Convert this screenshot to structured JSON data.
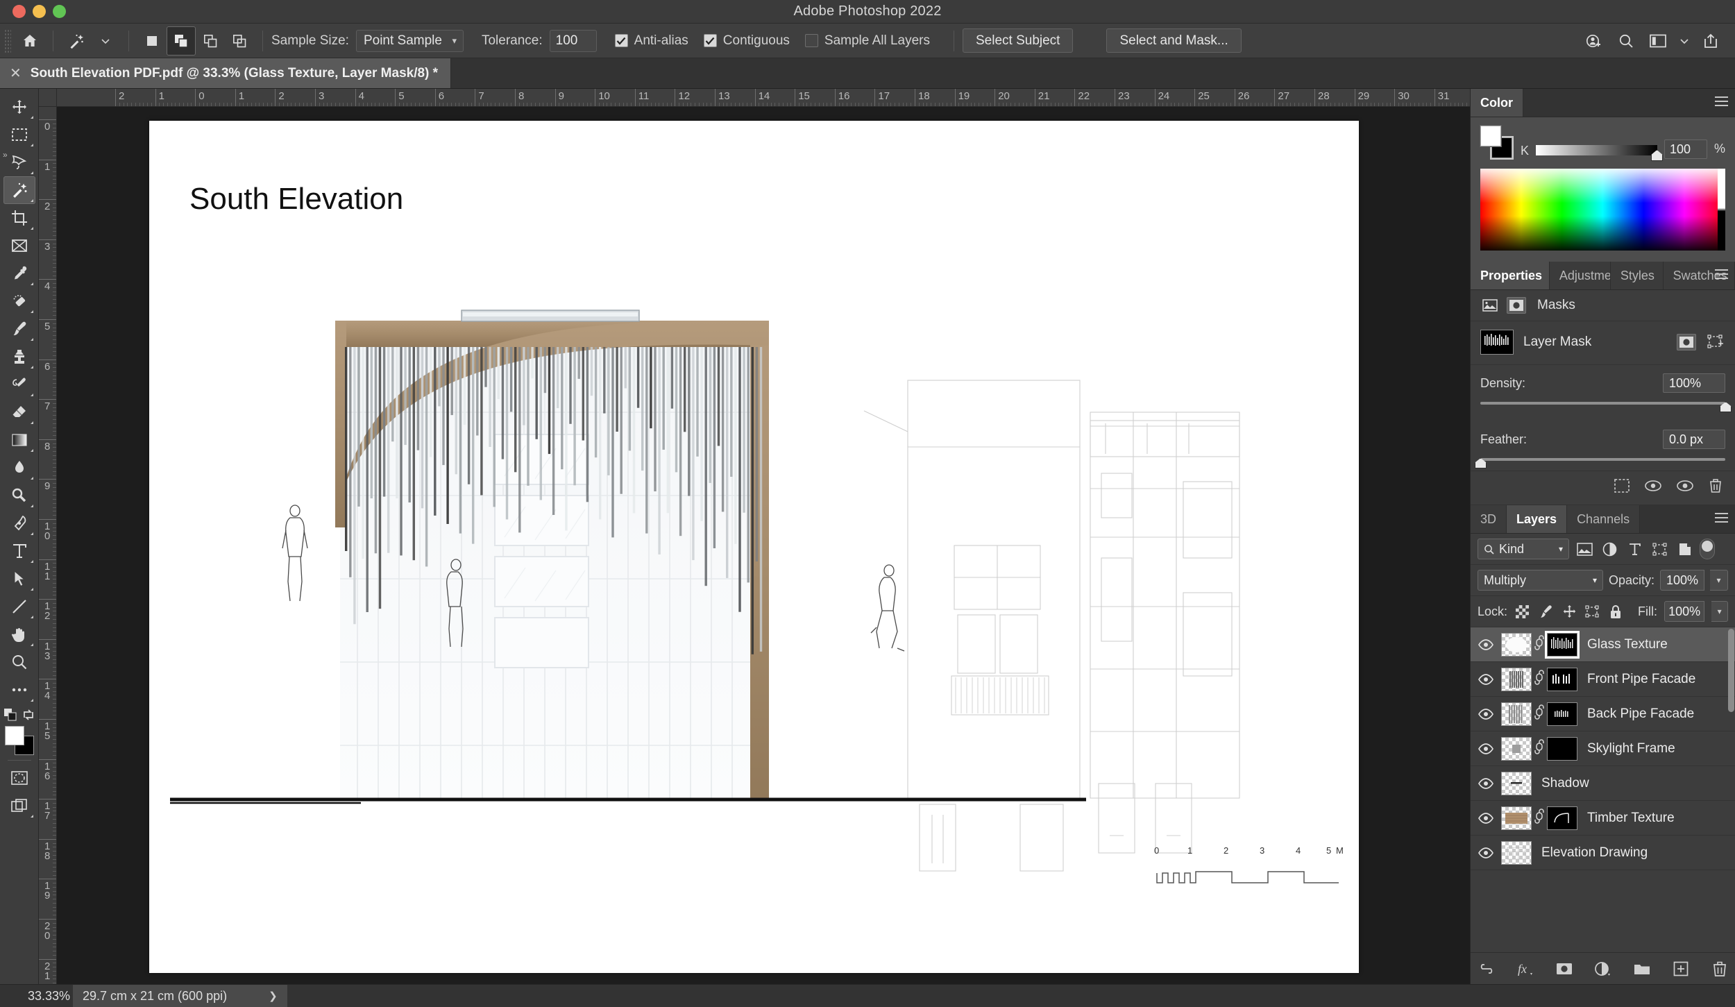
{
  "window": {
    "app_title": "Adobe Photoshop 2022"
  },
  "options_bar": {
    "home_icon": "home-icon",
    "tool_icon": "magic-wand-icon",
    "selection_modes": [
      "new-selection",
      "add-to-selection",
      "subtract-from-selection",
      "intersect-with-selection"
    ],
    "sample_size_label": "Sample Size:",
    "sample_size_value": "Point Sample",
    "tolerance_label": "Tolerance:",
    "tolerance_value": "100",
    "anti_alias_label": "Anti-alias",
    "anti_alias_checked": true,
    "contiguous_label": "Contiguous",
    "contiguous_checked": true,
    "sample_all_layers_label": "Sample All Layers",
    "sample_all_layers_checked": false,
    "select_subject_label": "Select Subject",
    "select_and_mask_label": "Select and Mask...",
    "right_icons": [
      "add-user-icon",
      "search-icon",
      "workspace-icon",
      "chevron-down-icon",
      "share-icon"
    ]
  },
  "document_tab": {
    "close_icon": "close-icon",
    "title": "South Elevation PDF.pdf @ 33.3% (Glass Texture, Layer Mask/8) *"
  },
  "toolbar": {
    "tools": [
      {
        "name": "move-tool",
        "active": false
      },
      {
        "name": "rectangular-marquee-tool",
        "active": false
      },
      {
        "name": "lasso-tool",
        "active": false
      },
      {
        "name": "magic-wand-tool",
        "active": true
      },
      {
        "name": "crop-tool",
        "active": false
      },
      {
        "name": "frame-tool",
        "active": false
      },
      {
        "name": "eyedropper-tool",
        "active": false
      },
      {
        "name": "spot-healing-brush-tool",
        "active": false
      },
      {
        "name": "brush-tool",
        "active": false
      },
      {
        "name": "clone-stamp-tool",
        "active": false
      },
      {
        "name": "history-brush-tool",
        "active": false
      },
      {
        "name": "eraser-tool",
        "active": false
      },
      {
        "name": "gradient-tool",
        "active": false
      },
      {
        "name": "blur-tool",
        "active": false
      },
      {
        "name": "dodge-tool",
        "active": false
      },
      {
        "name": "pen-tool",
        "active": false
      },
      {
        "name": "type-tool",
        "active": false
      },
      {
        "name": "path-selection-tool",
        "active": false
      },
      {
        "name": "line-tool",
        "active": false
      },
      {
        "name": "hand-tool",
        "active": false
      },
      {
        "name": "zoom-tool",
        "active": false
      },
      {
        "name": "edit-toolbar-tool",
        "active": false
      }
    ],
    "foreground_color": "#ffffff",
    "background_color": "#000000",
    "quick_mask_icon": "quick-mask-icon",
    "screen_mode_icon": "screen-mode-icon"
  },
  "rulers": {
    "unit": "cm",
    "horizontal_labels": [
      "2",
      "1",
      "0",
      "1",
      "2",
      "3",
      "4",
      "5",
      "6",
      "7",
      "8",
      "9",
      "10",
      "11",
      "12",
      "13",
      "14",
      "15",
      "16",
      "17",
      "18",
      "19",
      "20",
      "21",
      "22",
      "23",
      "24",
      "25",
      "26",
      "27",
      "28",
      "29",
      "30",
      "31"
    ],
    "vertical_labels": [
      "0",
      "1",
      "2",
      "3",
      "4",
      "5",
      "6",
      "7",
      "8",
      "9",
      "10",
      "11",
      "12",
      "13",
      "14",
      "15",
      "16",
      "17",
      "18",
      "19",
      "20",
      "21"
    ]
  },
  "canvas": {
    "drawing_title": "South Elevation",
    "scale_bar": {
      "labels": [
        "0",
        "1",
        "2",
        "3",
        "4",
        "5"
      ],
      "unit": "M"
    }
  },
  "color_panel": {
    "tab_label": "Color",
    "menu_icon": "panel-menu-icon",
    "channel_label": "K",
    "channel_value": "100",
    "unit": "%"
  },
  "properties_panel": {
    "tabs": [
      {
        "label": "Properties",
        "active": true
      },
      {
        "label": "Adjustme",
        "active": false
      },
      {
        "label": "Styles",
        "active": false
      },
      {
        "label": "Swatches",
        "active": false
      }
    ],
    "menu_icon": "panel-menu-icon",
    "header_label": "Masks",
    "pixel_mask_icon": "pixel-mask-icon",
    "vector_mask_icon": "vector-mask-icon",
    "mask_name": "Layer Mask",
    "select_mask_icon": "select-mask-icon",
    "add_vector_mask_icon": "add-vector-mask-icon",
    "density_label": "Density:",
    "density_value": "100%",
    "density_percent": 100,
    "feather_label": "Feather:",
    "feather_value": "0.0 px",
    "feather_percent": 0,
    "footer_icons": [
      "load-selection-icon",
      "apply-mask-icon",
      "toggle-mask-icon",
      "delete-mask-icon"
    ]
  },
  "layers_panel": {
    "tabs": [
      {
        "label": "3D",
        "active": false
      },
      {
        "label": "Layers",
        "active": true
      },
      {
        "label": "Channels",
        "active": false
      }
    ],
    "menu_icon": "panel-menu-icon",
    "filter_label": "Kind",
    "filter_icons": [
      "filter-pixel-icon",
      "filter-adjustment-icon",
      "filter-type-icon",
      "filter-shape-icon",
      "filter-smart-object-icon"
    ],
    "filter_toggle": "filter-enable-toggle",
    "blend_mode": "Multiply",
    "opacity_label": "Opacity:",
    "opacity_value": "100%",
    "lock_label": "Lock:",
    "lock_icons": [
      "lock-transparency-icon",
      "lock-image-icon",
      "lock-position-icon",
      "lock-artboard-icon",
      "lock-all-icon"
    ],
    "fill_label": "Fill:",
    "fill_value": "100%",
    "layers": [
      {
        "name": "Glass Texture",
        "visible": true,
        "selected": true,
        "has_mask": true,
        "mask_active": true,
        "thumb": "glass",
        "mask": "glass-mask"
      },
      {
        "name": "Front Pipe Facade",
        "visible": true,
        "selected": false,
        "has_mask": true,
        "mask_active": false,
        "thumb": "pipes",
        "mask": "front-pipes-mask"
      },
      {
        "name": "Back Pipe Facade",
        "visible": true,
        "selected": false,
        "has_mask": true,
        "mask_active": false,
        "thumb": "pipes2",
        "mask": "back-pipes-mask"
      },
      {
        "name": "Skylight Frame",
        "visible": true,
        "selected": false,
        "has_mask": true,
        "mask_active": false,
        "thumb": "skylight",
        "mask": "empty"
      },
      {
        "name": "Shadow",
        "visible": true,
        "selected": false,
        "has_mask": false,
        "mask_active": false,
        "thumb": "shadow",
        "mask": ""
      },
      {
        "name": "Timber Texture",
        "visible": true,
        "selected": false,
        "has_mask": true,
        "mask_active": false,
        "thumb": "timber",
        "mask": "timber-mask"
      },
      {
        "name": "Elevation Drawing",
        "visible": true,
        "selected": false,
        "has_mask": false,
        "mask_active": false,
        "thumb": "drawing",
        "mask": ""
      }
    ],
    "bottom_icons": [
      "link-layers-icon",
      "layer-style-fx-icon",
      "add-mask-icon",
      "adjustment-layer-icon",
      "new-group-icon",
      "new-layer-icon",
      "delete-layer-icon"
    ]
  },
  "status_bar": {
    "zoom": "33.33%",
    "doc_info": "29.7 cm x 21 cm (600 ppi)",
    "expand_icon": "chevron-right-icon"
  }
}
